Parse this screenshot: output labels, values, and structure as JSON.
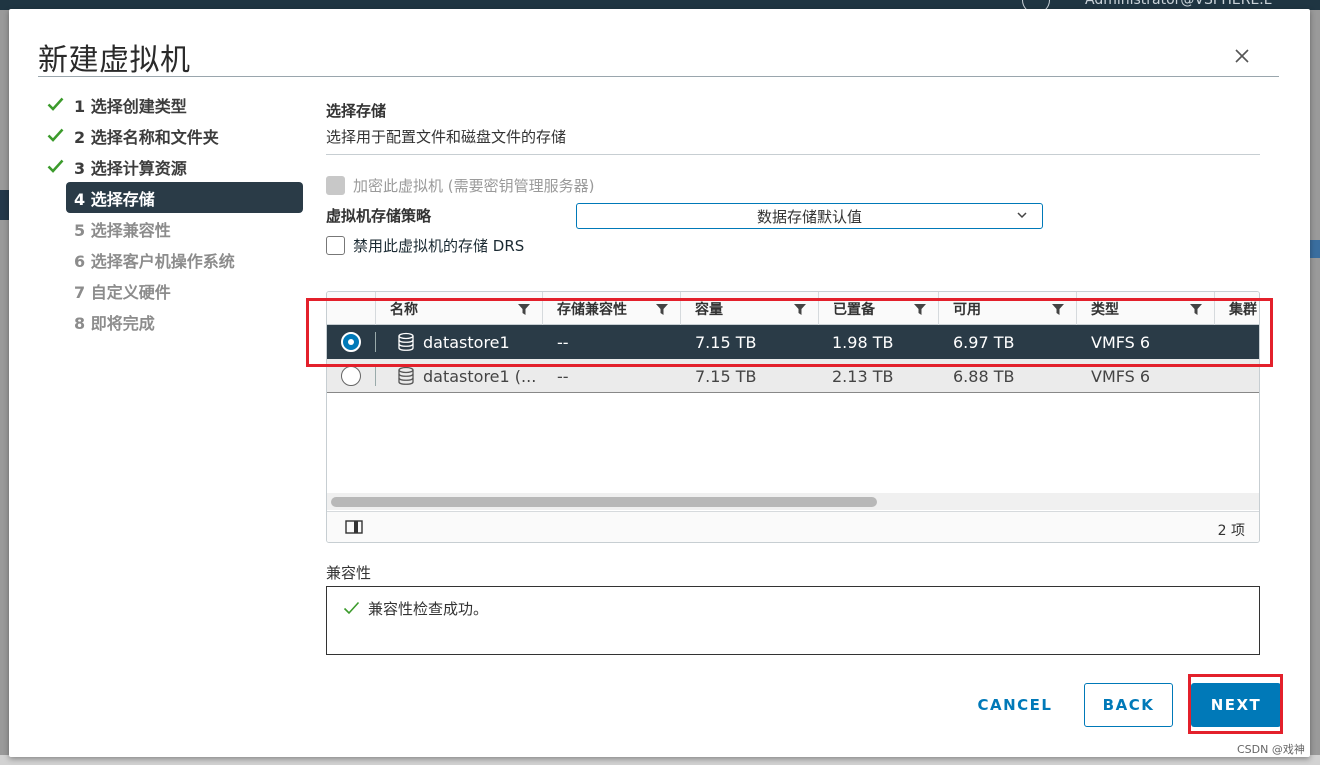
{
  "background": {
    "user_label": "Administrator@VSPHERE.L"
  },
  "dialog": {
    "title": "新建虚拟机",
    "close_label": "×"
  },
  "steps": [
    {
      "label": "1 选择创建类型",
      "state": "done"
    },
    {
      "label": "2 选择名称和文件夹",
      "state": "done"
    },
    {
      "label": "3 选择计算资源",
      "state": "done"
    },
    {
      "label": "4 选择存储",
      "state": "active"
    },
    {
      "label": "5 选择兼容性",
      "state": "disabled"
    },
    {
      "label": "6 选择客户机操作系统",
      "state": "disabled"
    },
    {
      "label": "7 自定义硬件",
      "state": "disabled"
    },
    {
      "label": "8 即将完成",
      "state": "disabled"
    }
  ],
  "section": {
    "title": "选择存储",
    "subtitle": "选择用于配置文件和磁盘文件的存储"
  },
  "encrypt_checkbox": {
    "label": "加密此虚拟机 (需要密钥管理服务器)",
    "checked": false,
    "disabled": true
  },
  "policy": {
    "label": "虚拟机存储策略",
    "selected": "数据存储默认值"
  },
  "drs_checkbox": {
    "label": "禁用此虚拟机的存储 DRS",
    "checked": false
  },
  "grid": {
    "columns": [
      "名称",
      "存储兼容性",
      "容量",
      "已置备",
      "可用",
      "类型",
      "集群"
    ],
    "rows": [
      {
        "selected": true,
        "name": "datastore1",
        "compat": "--",
        "capacity": "7.15 TB",
        "provisioned": "1.98 TB",
        "free": "6.97 TB",
        "type": "VMFS 6"
      },
      {
        "selected": false,
        "name": "datastore1 (...",
        "compat": "--",
        "capacity": "7.15 TB",
        "provisioned": "2.13 TB",
        "free": "6.88 TB",
        "type": "VMFS 6"
      }
    ],
    "count": "2 项"
  },
  "compat": {
    "label": "兼容性",
    "message": "兼容性检查成功。"
  },
  "buttons": {
    "cancel": "CANCEL",
    "back": "BACK",
    "next": "NEXT"
  },
  "watermark": "CSDN @戏神",
  "colors": {
    "accent": "#0079b8",
    "selected_row": "#2a3b47",
    "success": "#3c9b2c",
    "highlight": "#e3202b"
  }
}
